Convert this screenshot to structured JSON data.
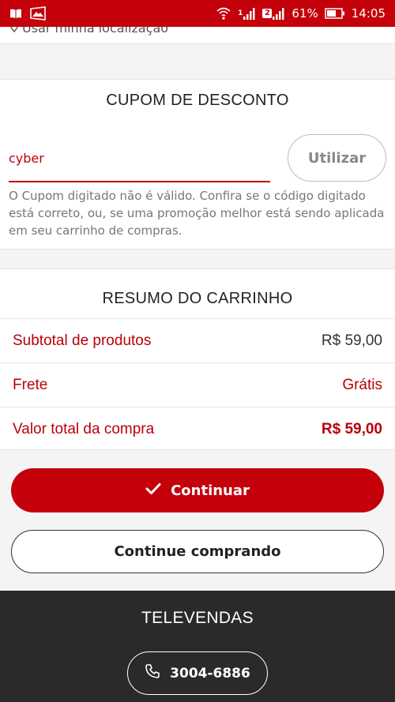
{
  "status_bar": {
    "battery": "61%",
    "time": "14:05",
    "sim_badge_1": "1",
    "sim_badge_2": "2",
    "icons": [
      "book-icon",
      "gallery-icon",
      "wifi-icon",
      "signal-1-icon",
      "signal-2-icon",
      "battery-icon"
    ]
  },
  "location": {
    "label": "Usar minha localização",
    "icon": "location-pin-icon"
  },
  "coupon": {
    "title": "CUPOM DE DESCONTO",
    "input_value": "cyber",
    "apply_label": "Utilizar",
    "error_message": "O Cupom digitado não é válido. Confira se o código digitado está correto, ou, se uma promoção melhor está sendo aplicada em seu carrinho de compras."
  },
  "summary": {
    "title": "RESUMO DO CARRINHO",
    "rows": [
      {
        "label": "Subtotal de produtos",
        "value": "R$ 59,00"
      },
      {
        "label": "Frete",
        "value": "Grátis"
      },
      {
        "label": "Valor total da compra",
        "value": "R$ 59,00"
      }
    ]
  },
  "actions": {
    "continue_label": "Continuar",
    "continue_shopping_label": "Continue comprando"
  },
  "footer": {
    "title": "TELEVENDAS",
    "phone": "3004-6886"
  },
  "colors": {
    "brand_red": "#c4000b",
    "footer_dark": "#2a2a2a"
  }
}
